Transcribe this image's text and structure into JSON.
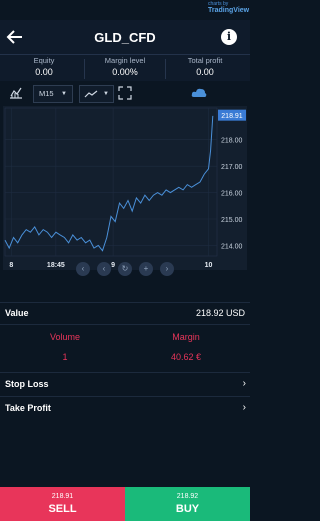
{
  "header": {
    "title": "GLD_CFD",
    "info_label": "i"
  },
  "stats": [
    {
      "label": "Equity",
      "value": "0.00"
    },
    {
      "label": "Margin level",
      "value": "0.00%"
    },
    {
      "label": "Total profit",
      "value": "0.00"
    }
  ],
  "toolbar": {
    "timeframe": "M15",
    "tv_small": "charts by",
    "tv_big": "TradingView"
  },
  "chart_data": {
    "type": "line",
    "ylim": [
      213.6,
      219.2
    ],
    "xlim": [
      0,
      100
    ],
    "y_ticks": [
      "218.00",
      "217.00",
      "216.00",
      "215.00",
      "214.00"
    ],
    "y_tick_values": [
      218,
      217,
      216,
      215,
      214
    ],
    "x_ticks": [
      "8",
      "18:45",
      "9",
      "10"
    ],
    "x_tick_positions": [
      3,
      24,
      51,
      96
    ],
    "last_price_label": "218.91",
    "last_price": 218.91,
    "series": [
      {
        "x": [
          0,
          2,
          4,
          6,
          8,
          10,
          12,
          14,
          16,
          18,
          20,
          22,
          24,
          26,
          28,
          30,
          32,
          34,
          36,
          38,
          40,
          42,
          44,
          46,
          48,
          50,
          52,
          54,
          56,
          58,
          60,
          62,
          64,
          66,
          68,
          70,
          72,
          74,
          76,
          78,
          80,
          82,
          84,
          86,
          88,
          90,
          92,
          94,
          96,
          97,
          98
        ],
        "values": [
          214.2,
          213.9,
          214.3,
          214.1,
          214.4,
          214.6,
          214.5,
          214.7,
          214.4,
          214.6,
          214.5,
          214.3,
          214.5,
          214.4,
          214.3,
          214.1,
          214.4,
          214.2,
          214.3,
          214.1,
          214.2,
          213.9,
          214.0,
          213.8,
          214.3,
          215.1,
          214.9,
          215.6,
          215.4,
          215.7,
          215.3,
          215.8,
          215.6,
          215.9,
          215.7,
          215.9,
          216.0,
          215.9,
          216.1,
          216.0,
          216.1,
          216.2,
          216.1,
          216.3,
          216.2,
          216.3,
          216.4,
          216.7,
          216.9,
          217.6,
          218.9
        ]
      }
    ]
  },
  "controls": [
    "‹",
    "‹",
    "↻",
    "+",
    "›"
  ],
  "value_row": {
    "label": "Value",
    "value": "218.92 USD"
  },
  "volume": {
    "label": "Volume",
    "value": "1"
  },
  "margin": {
    "label": "Margin",
    "value": "40.62 €"
  },
  "stop_loss": "Stop Loss",
  "take_profit": "Take Profit",
  "sell": {
    "price": "218.91",
    "label": "SELL"
  },
  "buy": {
    "price": "218.92",
    "label": "BUY"
  },
  "colors": {
    "sell": "#e8355a",
    "buy": "#1aba7a",
    "line": "#4a90d9",
    "accent": "#e8355a"
  }
}
